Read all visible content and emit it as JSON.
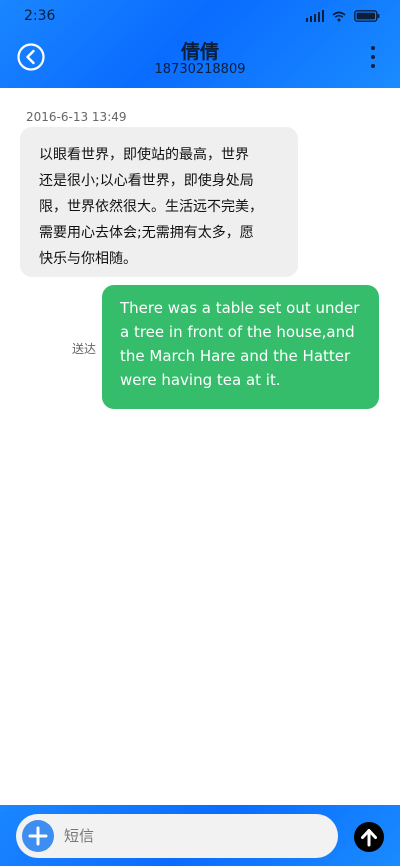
{
  "status_bar": {
    "time": "2:36",
    "icons": [
      "signal-icon",
      "wifi-icon",
      "battery-icon"
    ]
  },
  "header": {
    "contact_name": "倩倩",
    "contact_number": "18730218809",
    "back_icon": "chevron-left-circle-icon",
    "menu_icon": "more-vertical-icon"
  },
  "conversation": {
    "timestamp": "2016-6-13 13:49",
    "incoming_lines": [
      "以眼看世界，即使站的最高，世界",
      "还是很小;以心看世界，即使身处局",
      "限，世界依然很大。生活远不完美，",
      "需要用心去体会;无需拥有太多，愿",
      "快乐与你相随。"
    ],
    "outgoing_lines": [
      "There was a table set out under",
      "a tree in front of the house,and",
      "the March Hare and the Hatter",
      "were having tea at it."
    ],
    "delivery_status": "送达"
  },
  "composer": {
    "placeholder": "短信",
    "add_icon": "plus-circle-icon",
    "send_icon": "arrow-up-circle-icon"
  },
  "colors": {
    "header_blue": "#0a6cff",
    "incoming_bubble": "#efefef",
    "outgoing_bubble": "#35bd6b",
    "add_button": "#3d8ef0"
  }
}
